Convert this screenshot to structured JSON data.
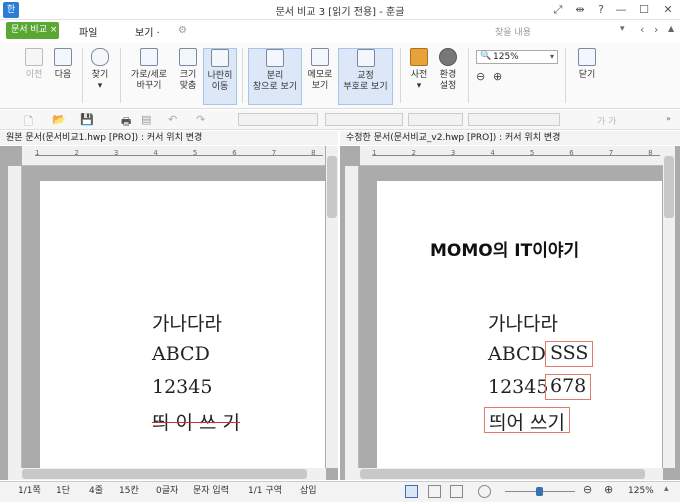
{
  "window": {
    "app_icon": "한",
    "title": "문서 비교 3 [읽기 전용] - 훈글"
  },
  "menubar": {
    "active_tab": "문서 비교 ×",
    "menus": [
      "파일",
      "보기 ·"
    ],
    "search_placeholder": "찾을 내용"
  },
  "ribbon": {
    "buttons": [
      {
        "label": "이전",
        "icon": "prev-icon",
        "disabled": true
      },
      {
        "label": "다음",
        "icon": "next-icon"
      },
      {
        "label": "찾기",
        "icon": "binoculars-icon"
      },
      {
        "label": "가로/세로\n바꾸기",
        "icon": "layout-swap-icon"
      },
      {
        "label": "크기\n맞춤",
        "icon": "fit-size-icon"
      },
      {
        "label": "나란히\n이동",
        "icon": "side-by-side-icon",
        "active": true
      },
      {
        "label": "분리\n창으로 보기",
        "icon": "split-window-icon",
        "active": true
      },
      {
        "label": "메모로\n보기",
        "icon": "memo-icon"
      },
      {
        "label": "교정\n부호로 보기",
        "icon": "proofread-icon",
        "active": true
      },
      {
        "label": "사전",
        "icon": "dictionary-icon"
      },
      {
        "label": "환경\n설정",
        "icon": "gear-icon"
      },
      {
        "label": "닫기",
        "icon": "close-door-icon"
      }
    ],
    "zoom": "125%"
  },
  "toolbar2": {
    "font_preview": "가 가"
  },
  "left_pane": {
    "header": "원본 문서(문서비교1.hwp [PRO]) : 커서 위치 변경",
    "lines": [
      "가나다라",
      "ABCD",
      "12345",
      "띄 이 쓰 기"
    ]
  },
  "right_pane": {
    "header": "수정한 문서(문서비교_v2.hwp [PRO]) : 커서 위치 변경",
    "watermark": "MOMO의 IT이야기",
    "lines": [
      "가나다라",
      "ABCD",
      "SSS",
      "12345",
      "678",
      "띄어 쓰기"
    ]
  },
  "status": {
    "page": "1/1쪽",
    "column": "1단",
    "line": "4줄",
    "col": "15칸",
    "chars": "0글자",
    "input_mode": "문자 입력",
    "section": "1/1 구역",
    "insert_mode": "삽입",
    "zoom": "125%"
  }
}
